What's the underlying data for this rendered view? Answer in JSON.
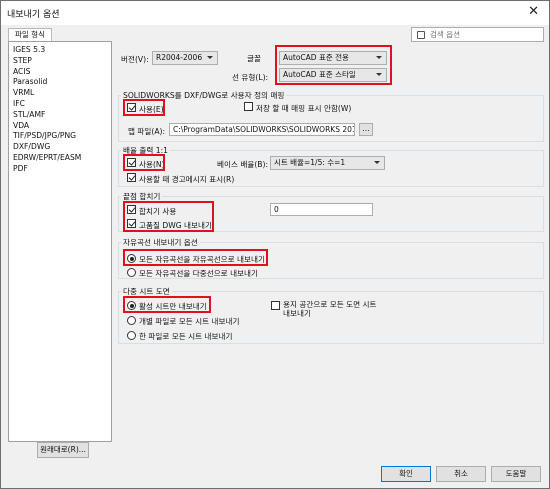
{
  "window": {
    "title": "내보내기 옵션",
    "close_glyph": "✕"
  },
  "left": {
    "tab_label": "파일 형식",
    "formats": [
      "IGES 5.3",
      "STEP",
      "ACIS",
      "Parasolid",
      "VRML",
      "IFC",
      "STL/AMF",
      "VDA",
      "TIF/PSD/JPG/PNG",
      "DXF/DWG",
      "EDRW/EPRT/EASM",
      "PDF"
    ],
    "reset_button": "원래대로(R)..."
  },
  "search": {
    "placeholder": "검색 옵션"
  },
  "top": {
    "version_label": "버전(V):",
    "version_value": "R2004-2006",
    "font_label": "글꼴",
    "font_value": "AutoCAD 표준 전용",
    "linestyle_label": "선 유형(L):",
    "linestyle_value": "AutoCAD 표준 스타일"
  },
  "mapping": {
    "title": "SOLIDWORKS를 DXF/DWG로 사용자 정의 매핑",
    "enable_label": "사용(E)",
    "no_prompt_label": "저장 할 때 매핑 표시 안함(W)",
    "map_file_label": "맵 파일(A):",
    "map_file_value": "C:\\ProgramData\\SOLIDWORKS\\SOLIDWORKS 2015\\la",
    "browse_label": "..."
  },
  "scale": {
    "title": "배율 출력 1:1",
    "enable_label": "사용(N)",
    "base_scale_label": "베이스 배율(B):",
    "base_scale_value": "시트 배율=1/5: 수=1",
    "warn_label": "사용할 때 경고메시지 표시(R)"
  },
  "merge": {
    "title": "끝점 합치기",
    "enable_label": "합치기 사용",
    "value": "0",
    "hq_label": "고품질 DWG 내보내기"
  },
  "spline": {
    "title": "자유곡선 내보내기 옵션",
    "opt1": "모든 자유곡선을 자유곡선으로 내보내기",
    "opt2": "모든 자유곡선을 다중선으로 내보내기"
  },
  "multisheet": {
    "title": "다중 시트 도면",
    "opt1": "활성 시트만 내보내기",
    "opt2": "개별 파일로 모든 시트 내보내기",
    "opt3": "한 파일로 모든 시트 내보내기",
    "paper_space_label": "용지 공간으로 모든 도면 시트 내보내기"
  },
  "buttons": {
    "ok": "확인",
    "cancel": "취소",
    "help": "도움말"
  }
}
